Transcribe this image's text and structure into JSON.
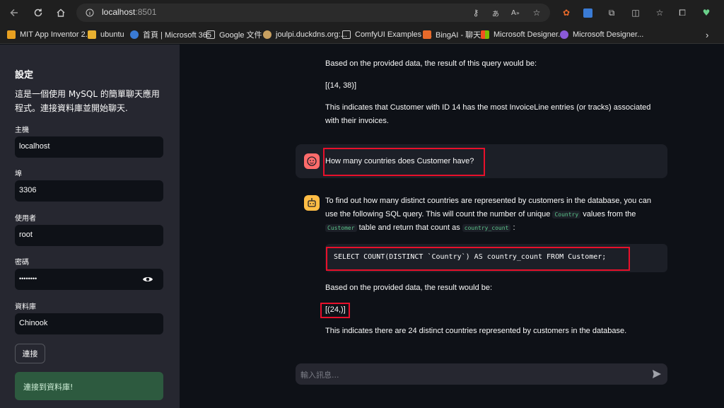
{
  "browser": {
    "url_host": "localhost",
    "url_port": ":8501",
    "bookmarks": [
      {
        "label": "MIT App Inventor 2...",
        "color": "#e8a020"
      },
      {
        "label": "ubuntu",
        "color": "#e8b030"
      },
      {
        "label": "首頁 | Microsoft 365",
        "color": "#3a7bd5"
      },
      {
        "label": "Google 文件",
        "color": "#cfcfcf"
      },
      {
        "label": "joulpi.duckdns.org:...",
        "color": "#c8a060"
      },
      {
        "label": "ComfyUI Examples |...",
        "color": "#cfcfcf"
      },
      {
        "label": "BingAI - 聊天",
        "color": "#e86a2a"
      },
      {
        "label": "Microsoft Designer...",
        "color": "#f25022"
      },
      {
        "label": "Microsoft Designer...",
        "color": "#8a5ad8"
      }
    ]
  },
  "sidebar": {
    "title": "設定",
    "description": "這是一個使用 MySQL 的簡單聊天應用程式。連接資料庫並開始聊天.",
    "host_label": "主機",
    "host_value": "localhost",
    "port_label": "埠",
    "port_value": "3306",
    "user_label": "使用者",
    "user_value": "root",
    "password_label": "密碼",
    "password_value": "••••••••",
    "database_label": "資料庫",
    "database_value": "Chinook",
    "connect_label": "連接",
    "success_message": "連接到資料庫!"
  },
  "chat": {
    "prev_result_intro": "Based on the provided data, the result of this query would be:",
    "prev_result_value": "[(14, 38)]",
    "prev_conclusion": "This indicates that Customer with ID 14 has the most InvoiceLine entries (or tracks) associated with their invoices.",
    "user_question": "How many countries does Customer have?",
    "answer_intro_1": "To find out how many distinct countries are represented by customers in the database, you can use the following SQL query. This will count the number of unique",
    "code_country": "Country",
    "answer_intro_2": "values from the",
    "code_customer": "Customer",
    "answer_intro_3": "table and return that count as",
    "code_country_count": "country_count",
    "answer_intro_4": ":",
    "sql_query": "SELECT COUNT(DISTINCT `Country`) AS country_count FROM Customer;",
    "result_intro": "Based on the provided data, the result would be:",
    "result_value": "[(24,)]",
    "conclusion": "This indicates there are 24 distinct countries represented by customers in the database.",
    "input_placeholder": "輸入訊息..."
  }
}
